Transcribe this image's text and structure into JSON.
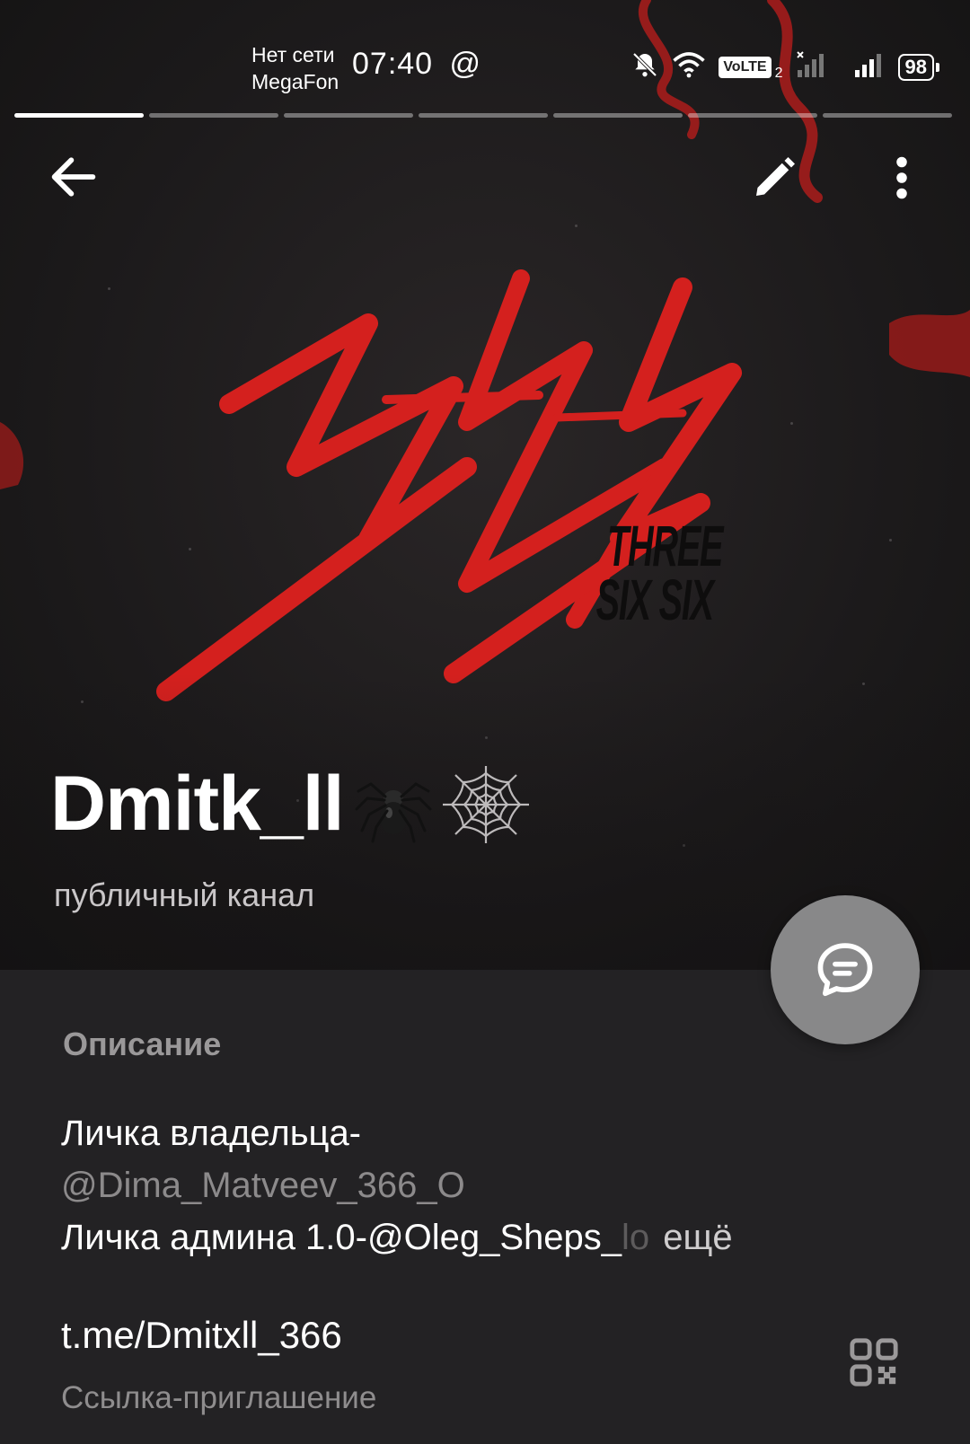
{
  "status_bar": {
    "network_status": "Нет сети",
    "carrier": "MegaFon",
    "time": "07:40",
    "volte": "VoLTE",
    "sim_slot": "2",
    "battery": "98"
  },
  "story_progress": {
    "total_segments": 7,
    "active_segment": 1
  },
  "toolbar": {
    "back_icon": "arrow-left-icon",
    "edit_icon": "pencil-icon",
    "more_icon": "more-vertical-icon"
  },
  "cover": {
    "logo_text_line1": "THREE",
    "logo_text_line2": "SIX SIX"
  },
  "channel": {
    "name": "Dmitk_ll",
    "emoji": "🕷️🕸️",
    "type": "публичный канал"
  },
  "description": {
    "label": "Описание",
    "line1": "Личка владельца-",
    "line2": "@Dima_Matveev_366_O",
    "line3_main": "Личка админа 1.0-@Oleg_Sheps_",
    "line3_faded": "lo",
    "more": "ещё"
  },
  "invite": {
    "link": "t.me/Dmitxll_366",
    "caption": "Ссылка-приглашение"
  },
  "colors": {
    "accent_red": "#d4201e",
    "background": "#232224",
    "fab": "#888889",
    "muted_text": "#9a9899"
  }
}
